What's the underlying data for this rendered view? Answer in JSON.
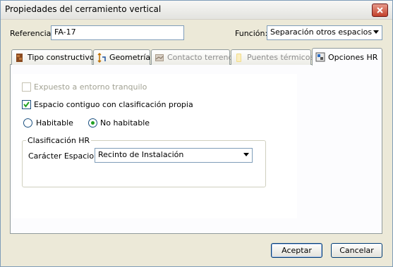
{
  "window": {
    "title": "Propiedades del cerramiento vertical"
  },
  "header": {
    "referencia_label": "Referencia:",
    "referencia_value": "FA-17",
    "funcion_label": "Función:",
    "funcion_value": "Separación otros espacios"
  },
  "tabs": [
    {
      "label": "Tipo constructivo",
      "icon": "wall-icon",
      "state": "enabled"
    },
    {
      "label": "Geometría",
      "icon": "dimensions-icon",
      "state": "enabled"
    },
    {
      "label": "Contacto terreno",
      "icon": "terrain-icon",
      "state": "disabled"
    },
    {
      "label": "Puentes térmicos",
      "icon": "thermal-bridge-icon",
      "state": "disabled"
    },
    {
      "label": "Opciones HR",
      "icon": "hr-options-icon",
      "state": "active"
    }
  ],
  "options": {
    "expuesto_label": "Expuesto a entorno tranquilo",
    "expuesto_checked": false,
    "espacio_label": "Espacio contiguo con clasificación propia",
    "espacio_checked": true,
    "habitable_label": "Habitable",
    "no_habitable_label": "No habitable",
    "selected_radio": "No habitable"
  },
  "clasificacion": {
    "group_title": "Clasificación HR",
    "caracter_label": "Carácter Espacio:",
    "caracter_value": "Recinto de Instalación"
  },
  "buttons": {
    "accept": "Aceptar",
    "cancel": "Cancelar"
  }
}
